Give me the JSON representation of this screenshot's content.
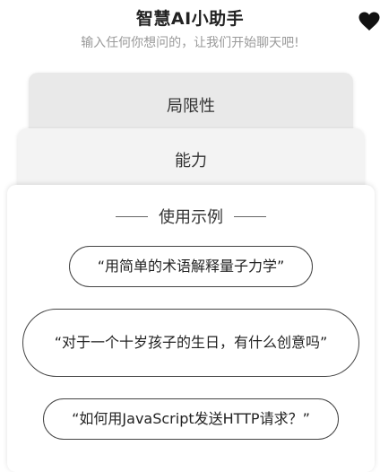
{
  "header": {
    "title": "智慧AI小助手",
    "subtitle": "输入任何你想问的，让我们开始聊天吧!",
    "favorite_icon": "heart-icon"
  },
  "cards": {
    "back_label": "局限性",
    "middle_label": "能力",
    "front_heading": "使用示例"
  },
  "examples": [
    "“用简单的术语解释量子力学”",
    "“对于一个十岁孩子的生日，有什么创意吗”",
    "“如何用JavaScript发送HTTP请求？”"
  ],
  "colors": {
    "background": "#ffffff",
    "back_card": "#e9e9e9",
    "middle_card": "#f3f3f3",
    "subtitle_text": "#9a9a9a",
    "border": "#444444"
  }
}
